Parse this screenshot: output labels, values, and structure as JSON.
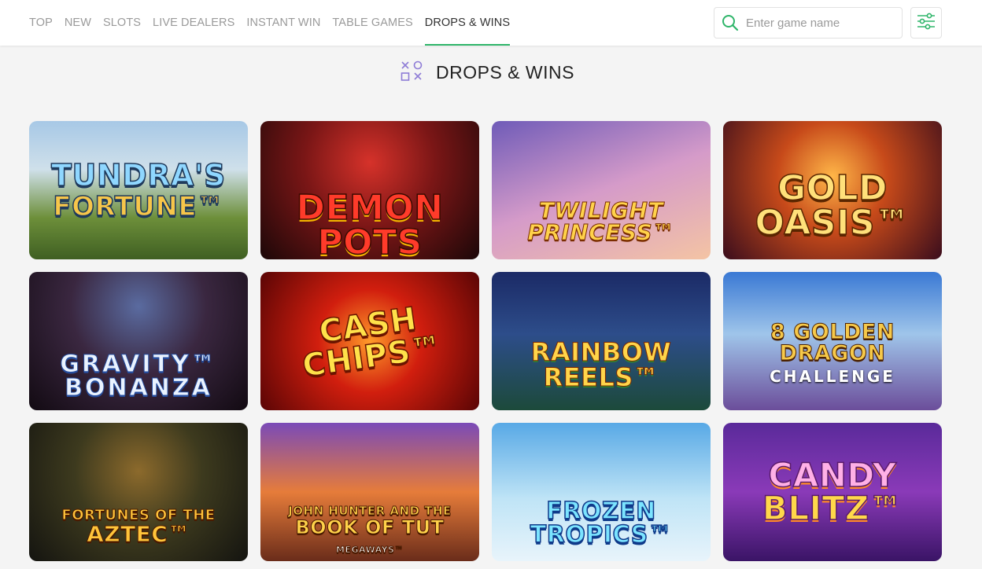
{
  "nav": {
    "items": [
      {
        "label": "TOP",
        "active": false
      },
      {
        "label": "NEW",
        "active": false
      },
      {
        "label": "SLOTS",
        "active": false
      },
      {
        "label": "LIVE DEALERS",
        "active": false
      },
      {
        "label": "INSTANT WIN",
        "active": false
      },
      {
        "label": "TABLE GAMES",
        "active": false
      },
      {
        "label": "DROPS & WINS",
        "active": true
      }
    ]
  },
  "search": {
    "placeholder": "Enter game name",
    "value": ""
  },
  "filter": {
    "icon": "sliders-icon"
  },
  "section": {
    "icon": "xo-games-icon",
    "title": "DROPS & WINS"
  },
  "games": [
    {
      "line1": "TUNDRA'S",
      "line2": "FORTUNE™"
    },
    {
      "line1": "DEMON POTS",
      "line2": ""
    },
    {
      "line1": "Twilight",
      "line2": "Princess™"
    },
    {
      "line1": "GOLD",
      "line2": "OASIS™"
    },
    {
      "line1": "GRAVITY™",
      "line2": "BONANZA"
    },
    {
      "line1": "CASH",
      "line2": "CHIPS™"
    },
    {
      "line1": "Rainbow",
      "line2": "Reels™"
    },
    {
      "line1": "8 GOLDEN DRAGON",
      "line2": "CHALLENGE"
    },
    {
      "line1": "FORTUNES OF THE",
      "line2": "AZTEC™"
    },
    {
      "line1": "JOHN HUNTER and the",
      "line2": "BOOK OF TUT",
      "line3": "MEGAWAYS™"
    },
    {
      "line1": "FROZEN",
      "line2": "TROPICS™"
    },
    {
      "line1": "CANDY",
      "line2": "Blitz™"
    }
  ],
  "colors": {
    "accent": "#2fb56a",
    "section_icon": "#8e7cd6",
    "nav_inactive": "#9a9a9a",
    "nav_active": "#333333"
  }
}
